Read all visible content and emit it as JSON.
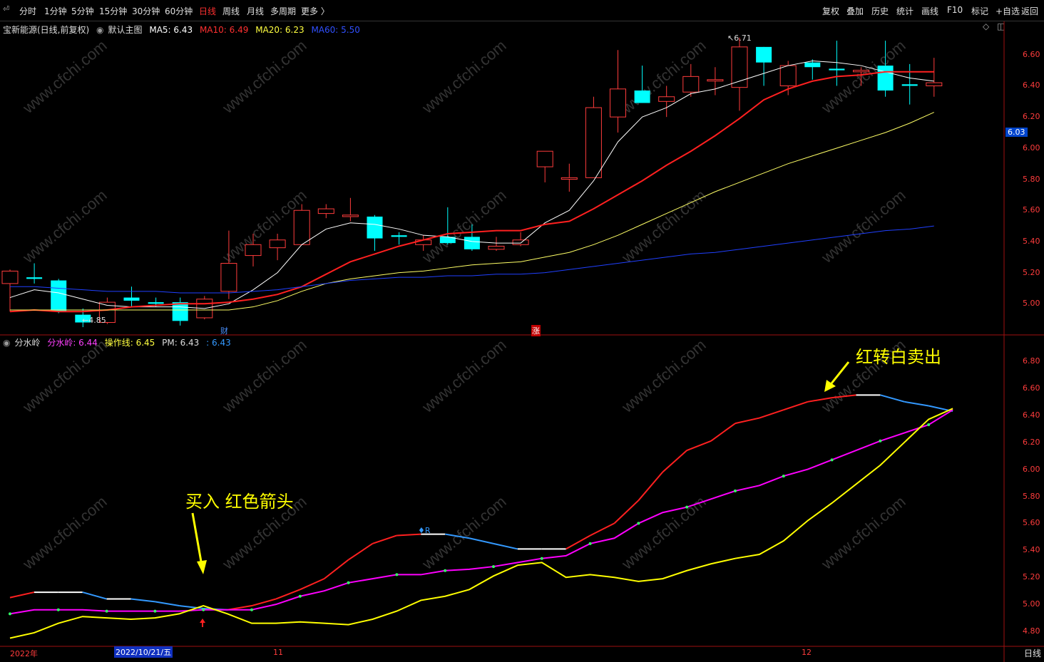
{
  "toolbar": {
    "timeframes": [
      "分时",
      "1分钟",
      "5分钟",
      "15分钟",
      "30分钟",
      "60分钟",
      "日线",
      "周线",
      "月线",
      "多周期",
      "更多 〉"
    ],
    "active_timeframe": "日线",
    "right_buttons": [
      "复权",
      "叠加",
      "历史",
      "统计",
      "画线",
      "F10",
      "+自选",
      "返回"
    ],
    "mark_button": "标记"
  },
  "main_legend": {
    "name": "宝新能源(日线,前复权)",
    "indicator": "默认主图",
    "ma5": "MA5: 6.43",
    "ma10": "MA10: 6.49",
    "ma20": "MA20: 6.23",
    "ma60": "MA60: 5.50"
  },
  "sub_legend": {
    "name": "分水岭",
    "line1": "分水岭: 6.44",
    "line2": "操作线: 6.45",
    "line3": "PM: 6.43",
    "line4": ": 6.43"
  },
  "main_axis": [
    "6.60",
    "6.40",
    "6.20",
    "6.00",
    "5.80",
    "5.60",
    "5.40",
    "5.20",
    "5.00"
  ],
  "sub_axis": [
    "6.80",
    "6.60",
    "6.40",
    "6.20",
    "6.00",
    "5.80",
    "5.60",
    "5.40",
    "5.20",
    "5.00",
    "4.80"
  ],
  "current_price": "6.03",
  "high_label": "6.71",
  "low_label": "4.85",
  "tags": {
    "cai": "财",
    "zhang": "涨",
    "r": "R"
  },
  "dates": [
    "2022年",
    "2022/10/21/五",
    "11",
    "12"
  ],
  "period_tab": "日线",
  "annotations": {
    "buy": "买入 红色箭头",
    "sell": "红转白卖出"
  },
  "colors": {
    "up": "#ff3c3c",
    "down": "#00ffff",
    "ma5": "#ffffff",
    "ma10": "#ff2020",
    "ma20": "#ffff66",
    "ma60": "#2040ff",
    "watershed": "#ff00ff",
    "oper": "#ffff00",
    "pm_up": "#ff2020",
    "pm_down": "#3399ff"
  },
  "chart_data": [
    {
      "type": "candlestick",
      "title": "宝新能源(日线,前复权)",
      "ylim": [
        4.8,
        6.75
      ],
      "candles": [
        {
          "o": 5.13,
          "c": 5.21,
          "h": 5.22,
          "l": 4.95
        },
        {
          "o": 5.17,
          "c": 5.16,
          "h": 5.26,
          "l": 5.13
        },
        {
          "o": 5.15,
          "c": 4.95,
          "h": 5.16,
          "l": 4.94
        },
        {
          "o": 4.93,
          "c": 4.88,
          "h": 4.97,
          "l": 4.85
        },
        {
          "o": 4.88,
          "c": 5.01,
          "h": 5.04,
          "l": 4.87
        },
        {
          "o": 5.04,
          "c": 5.02,
          "h": 5.11,
          "l": 4.98
        },
        {
          "o": 5.01,
          "c": 5.0,
          "h": 5.04,
          "l": 4.98
        },
        {
          "o": 5.01,
          "c": 4.89,
          "h": 5.04,
          "l": 4.86
        },
        {
          "o": 4.91,
          "c": 5.03,
          "h": 5.05,
          "l": 4.9
        },
        {
          "o": 5.08,
          "c": 5.26,
          "h": 5.47,
          "l": 5.03
        },
        {
          "o": 5.31,
          "c": 5.38,
          "h": 5.45,
          "l": 5.24
        },
        {
          "o": 5.36,
          "c": 5.41,
          "h": 5.45,
          "l": 5.28
        },
        {
          "o": 5.38,
          "c": 5.6,
          "h": 5.64,
          "l": 5.38
        },
        {
          "o": 5.58,
          "c": 5.61,
          "h": 5.64,
          "l": 5.55
        },
        {
          "o": 5.56,
          "c": 5.57,
          "h": 5.68,
          "l": 5.53
        },
        {
          "o": 5.56,
          "c": 5.42,
          "h": 5.57,
          "l": 5.34
        },
        {
          "o": 5.44,
          "c": 5.43,
          "h": 5.46,
          "l": 5.38
        },
        {
          "o": 5.38,
          "c": 5.41,
          "h": 5.44,
          "l": 5.34
        },
        {
          "o": 5.43,
          "c": 5.39,
          "h": 5.62,
          "l": 5.38
        },
        {
          "o": 5.43,
          "c": 5.35,
          "h": 5.51,
          "l": 5.34
        },
        {
          "o": 5.35,
          "c": 5.37,
          "h": 5.43,
          "l": 5.34
        },
        {
          "o": 5.38,
          "c": 5.41,
          "h": 5.46,
          "l": 5.37
        },
        {
          "o": 5.88,
          "c": 5.98,
          "h": 5.98,
          "l": 5.78
        },
        {
          "o": 5.8,
          "c": 5.81,
          "h": 5.9,
          "l": 5.72
        },
        {
          "o": 5.81,
          "c": 6.26,
          "h": 6.33,
          "l": 5.81
        },
        {
          "o": 6.2,
          "c": 6.38,
          "h": 6.63,
          "l": 6.1
        },
        {
          "o": 6.37,
          "c": 6.29,
          "h": 6.53,
          "l": 6.29
        },
        {
          "o": 6.3,
          "c": 6.33,
          "h": 6.4,
          "l": 6.2
        },
        {
          "o": 6.36,
          "c": 6.46,
          "h": 6.54,
          "l": 6.33
        },
        {
          "o": 6.44,
          "c": 6.44,
          "h": 6.52,
          "l": 6.34
        },
        {
          "o": 6.39,
          "c": 6.65,
          "h": 6.71,
          "l": 6.24
        },
        {
          "o": 6.65,
          "c": 6.55,
          "h": 6.65,
          "l": 6.4
        },
        {
          "o": 6.4,
          "c": 6.53,
          "h": 6.56,
          "l": 6.34
        },
        {
          "o": 6.55,
          "c": 6.52,
          "h": 6.57,
          "l": 6.44
        },
        {
          "o": 6.51,
          "c": 6.5,
          "h": 6.69,
          "l": 6.4
        },
        {
          "o": 6.49,
          "c": 6.5,
          "h": 6.52,
          "l": 6.4
        },
        {
          "o": 6.53,
          "c": 6.37,
          "h": 6.69,
          "l": 6.33
        },
        {
          "o": 6.41,
          "c": 6.4,
          "h": 6.54,
          "l": 6.28
        },
        {
          "o": 6.4,
          "c": 6.42,
          "h": 6.58,
          "l": 6.33
        }
      ],
      "series": [
        {
          "name": "MA5",
          "values": [
            5.04,
            5.09,
            5.07,
            5.03,
            4.99,
            4.98,
            4.98,
            4.98,
            4.97,
            5.0,
            5.09,
            5.2,
            5.38,
            5.48,
            5.52,
            5.51,
            5.48,
            5.44,
            5.43,
            5.4,
            5.39,
            5.39,
            5.52,
            5.6,
            5.79,
            6.04,
            6.2,
            6.26,
            6.35,
            6.38,
            6.43,
            6.48,
            6.53,
            6.56,
            6.55,
            6.53,
            6.49,
            6.45,
            6.43
          ]
        },
        {
          "name": "MA10",
          "values": [
            4.95,
            4.96,
            4.95,
            4.95,
            4.96,
            4.98,
            4.99,
            5.0,
            5.0,
            5.01,
            5.03,
            5.06,
            5.11,
            5.19,
            5.27,
            5.32,
            5.37,
            5.41,
            5.45,
            5.46,
            5.47,
            5.47,
            5.51,
            5.53,
            5.61,
            5.7,
            5.79,
            5.89,
            5.98,
            6.08,
            6.19,
            6.31,
            6.38,
            6.43,
            6.46,
            6.47,
            6.49,
            6.49,
            6.49
          ]
        },
        {
          "name": "MA20",
          "values": [
            4.96,
            4.96,
            4.96,
            4.96,
            4.96,
            4.96,
            4.96,
            4.96,
            4.96,
            4.96,
            4.98,
            5.02,
            5.08,
            5.13,
            5.16,
            5.18,
            5.2,
            5.21,
            5.23,
            5.25,
            5.26,
            5.27,
            5.3,
            5.33,
            5.38,
            5.44,
            5.51,
            5.58,
            5.65,
            5.72,
            5.78,
            5.84,
            5.9,
            5.95,
            6.0,
            6.05,
            6.1,
            6.16,
            6.23
          ]
        },
        {
          "name": "MA60",
          "values": [
            5.11,
            5.11,
            5.1,
            5.09,
            5.08,
            5.08,
            5.08,
            5.07,
            5.07,
            5.07,
            5.08,
            5.09,
            5.11,
            5.13,
            5.15,
            5.16,
            5.17,
            5.17,
            5.18,
            5.18,
            5.19,
            5.19,
            5.2,
            5.22,
            5.24,
            5.26,
            5.28,
            5.3,
            5.32,
            5.33,
            5.35,
            5.37,
            5.39,
            5.41,
            5.43,
            5.45,
            5.47,
            5.48,
            5.5
          ]
        }
      ]
    },
    {
      "type": "line",
      "title": "分水岭",
      "ylim": [
        4.7,
        6.9
      ],
      "series": [
        {
          "name": "PM",
          "values": [
            5.05,
            5.09,
            5.09,
            5.09,
            5.04,
            5.04,
            5.02,
            4.99,
            4.97,
            4.96,
            4.99,
            5.04,
            5.11,
            5.19,
            5.33,
            5.45,
            5.51,
            5.52,
            5.52,
            5.49,
            5.45,
            5.41,
            5.41,
            5.41,
            5.51,
            5.6,
            5.77,
            5.98,
            6.14,
            6.21,
            6.34,
            6.38,
            6.44,
            6.5,
            6.53,
            6.55,
            6.55,
            6.5,
            6.47,
            6.43
          ]
        },
        {
          "name": "分水岭",
          "values": [
            4.93,
            4.96,
            4.96,
            4.96,
            4.95,
            4.95,
            4.95,
            4.95,
            4.96,
            4.96,
            4.96,
            5.0,
            5.06,
            5.1,
            5.16,
            5.19,
            5.22,
            5.22,
            5.25,
            5.26,
            5.28,
            5.31,
            5.34,
            5.36,
            5.45,
            5.49,
            5.6,
            5.68,
            5.72,
            5.78,
            5.84,
            5.88,
            5.95,
            6.0,
            6.07,
            6.14,
            6.21,
            6.27,
            6.33,
            6.44
          ]
        },
        {
          "name": "操作线",
          "values": [
            4.75,
            4.79,
            4.86,
            4.91,
            4.9,
            4.89,
            4.9,
            4.93,
            4.99,
            4.93,
            4.86,
            4.86,
            4.87,
            4.86,
            4.85,
            4.89,
            4.95,
            5.03,
            5.06,
            5.11,
            5.21,
            5.29,
            5.31,
            5.2,
            5.22,
            5.2,
            5.17,
            5.19,
            5.25,
            5.3,
            5.34,
            5.37,
            5.47,
            5.62,
            5.75,
            5.89,
            6.03,
            6.2,
            6.37,
            6.45
          ]
        }
      ]
    }
  ]
}
